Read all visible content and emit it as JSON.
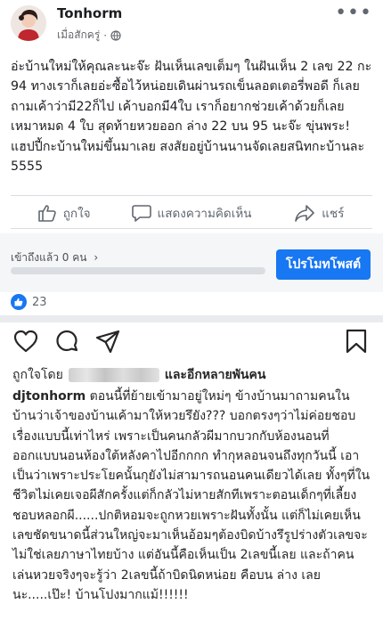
{
  "facebook": {
    "author": "Tonhorm",
    "timestamp": "เมื่อสักครู่",
    "audience_icon": "globe-icon",
    "more_icon": "more-dots-icon",
    "post_text": "อ่ะบ้านใหม่ให้คุณละนะจ๊ะ ฝันเห็นเลขเต็มๆ ในฝันเห็น 2 เลข 22 กะ 94 ทางเราก็เลยอ่ะซื้อไว้หน่อยเดินผ่านรถเข็นลอตเตอรี่พอดี ก็เลยถามเค้าว่ามี22ก็ไป เค้าบอกมี4ใบ เราก็อยากช่วยเค้าด้วยก็เลยเหมาหมด 4 ใบ สุดท้ายหวยออก ล่าง 22 บน 95 นะจ๊ะ ขุ่นพระ! แฮปปี้กะบ้านใหม่ขึ้นมาเลย สงสัยอยู่บ้านนานจัดเลยสนิทกะบ้านละ 5555",
    "actions": {
      "like": "ถูกใจ",
      "comment": "แสดงความคิดเห็น",
      "share": "แชร์"
    },
    "reach_text": "เข้าถึงแล้ว 0 คน",
    "reach_arrow": "›",
    "boost_button": "โปรโมทโพสต์",
    "reaction_count": "23",
    "accent_color": "#1877f2"
  },
  "instagram": {
    "liked_by_prefix": "ถูกใจโดย",
    "liked_by_suffix": "และอีกหลายพันคน",
    "username": "djtonhorm",
    "caption": "ตอนนี้ที่ย้ายเข้ามาอยู่ใหม่ๆ ข้างบ้านมาถามคนในบ้านว่าเจ้าของบ้านเค้ามาให้หวยรึยัง??? บอกตรงๆว่าไม่ค่อยชอบเรื่องแบบนี้เท่าไหร่ เพราะเป็นคนกลัวผีมากบวกกับห้องนอนที่ออกแบบนอนห้องใต้หลังคาไปอีกกกก ทำกุหลอนจนถึงทุกวันนี้ เอาเป็นว่าเพราะประโยคนั้นกุยังไม่สามารถนอนคนเดียวได้เลย ทั้งๆที่ในชีวิตไม่เคยเจอผีสักครั้งแต่ก็กลัวไม่หายสักทีเพราะตอนเด็กๆที่เลี้ยงชอบหลอกผี......ปกติหอมจะถูกหวยเพราะฝันทั้งนั้น แต่ก็ไม่เคยเห็นเลขชัดขนาดนี้ส่วนใหญ่จะมาเห็นอ้อมๆต้องบิดบ้างรึรูปร่างตัวเลขจะไม่ใช่เลยภาษาไทยบ้าง แต่อันนี้คือเห็นเป็น 2เลขนี้เลย และถ้าคนเล่นหวยจริงๆจะรู้ว่า 2เลขนี้ถ้าบิดนิดหน่อย คือบน ล่าง เลยนะ.....เป๊ะ! บ้านโปงมากแม้!!!!!!"
  }
}
